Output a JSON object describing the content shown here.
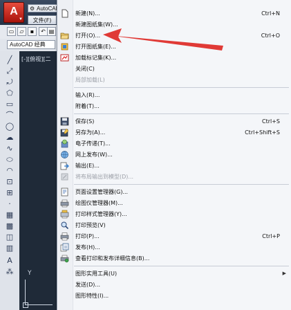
{
  "app": {
    "logo_letter": "A",
    "title": "AutoCAD",
    "file_menu": "文件(F)",
    "workspace": "AutoCAD 经典",
    "viewport_label": "[-][俯视][二"
  },
  "menu": {
    "items": [
      {
        "label": "新建(N)...",
        "shortcut": "Ctrl+N",
        "icon": "new-file-icon"
      },
      {
        "label": "新建图纸集(W)...",
        "shortcut": "",
        "icon": ""
      },
      {
        "label": "打开(O)...",
        "shortcut": "Ctrl+O",
        "icon": "open-folder-icon"
      },
      {
        "label": "打开图纸集(E)...",
        "shortcut": "",
        "icon": "open-sheetset-icon"
      },
      {
        "label": "加载标记集(K)...",
        "shortcut": "",
        "icon": "markup-set-icon"
      },
      {
        "label": "关闭(C)",
        "shortcut": "",
        "icon": ""
      },
      {
        "label": "局部加载(L)",
        "shortcut": "",
        "icon": "",
        "disabled": true
      },
      {
        "label": "输入(R)...",
        "shortcut": "",
        "icon": ""
      },
      {
        "label": "附着(T)...",
        "shortcut": "",
        "icon": ""
      },
      {
        "label": "保存(S)",
        "shortcut": "Ctrl+S",
        "icon": "save-icon"
      },
      {
        "label": "另存为(A)...",
        "shortcut": "Ctrl+Shift+S",
        "icon": "save-as-icon"
      },
      {
        "label": "电子传递(T)...",
        "shortcut": "",
        "icon": "etransmit-icon"
      },
      {
        "label": "网上发布(W)...",
        "shortcut": "",
        "icon": "publish-web-icon"
      },
      {
        "label": "输出(E)...",
        "shortcut": "",
        "icon": "export-icon"
      },
      {
        "label": "将布局输出到模型(D)...",
        "shortcut": "",
        "icon": "export-layout-icon",
        "disabled": true
      },
      {
        "label": "页面设置管理器(G)...",
        "shortcut": "",
        "icon": "page-setup-icon"
      },
      {
        "label": "绘图仪管理器(M)...",
        "shortcut": "",
        "icon": "plotter-manager-icon"
      },
      {
        "label": "打印样式管理器(Y)...",
        "shortcut": "",
        "icon": "plot-style-icon"
      },
      {
        "label": "打印预览(V)",
        "shortcut": "",
        "icon": "plot-preview-icon"
      },
      {
        "label": "打印(P)...",
        "shortcut": "Ctrl+P",
        "icon": "print-icon"
      },
      {
        "label": "发布(H)...",
        "shortcut": "",
        "icon": "publish-icon"
      },
      {
        "label": "查看打印和发布详细信息(B)...",
        "shortcut": "",
        "icon": "plot-details-icon"
      },
      {
        "label": "图形实用工具(U)",
        "shortcut": "",
        "icon": "",
        "submenu": true
      },
      {
        "label": "发送(D)...",
        "shortcut": "",
        "icon": ""
      },
      {
        "label": "图形特性(I)...",
        "shortcut": "",
        "icon": ""
      }
    ]
  },
  "annotation": {
    "color": "#e03a36"
  },
  "colors": {
    "accent": "#c41a12",
    "menu_bg": "#f4f6f9"
  },
  "ucs": {
    "y_label": "Y"
  }
}
